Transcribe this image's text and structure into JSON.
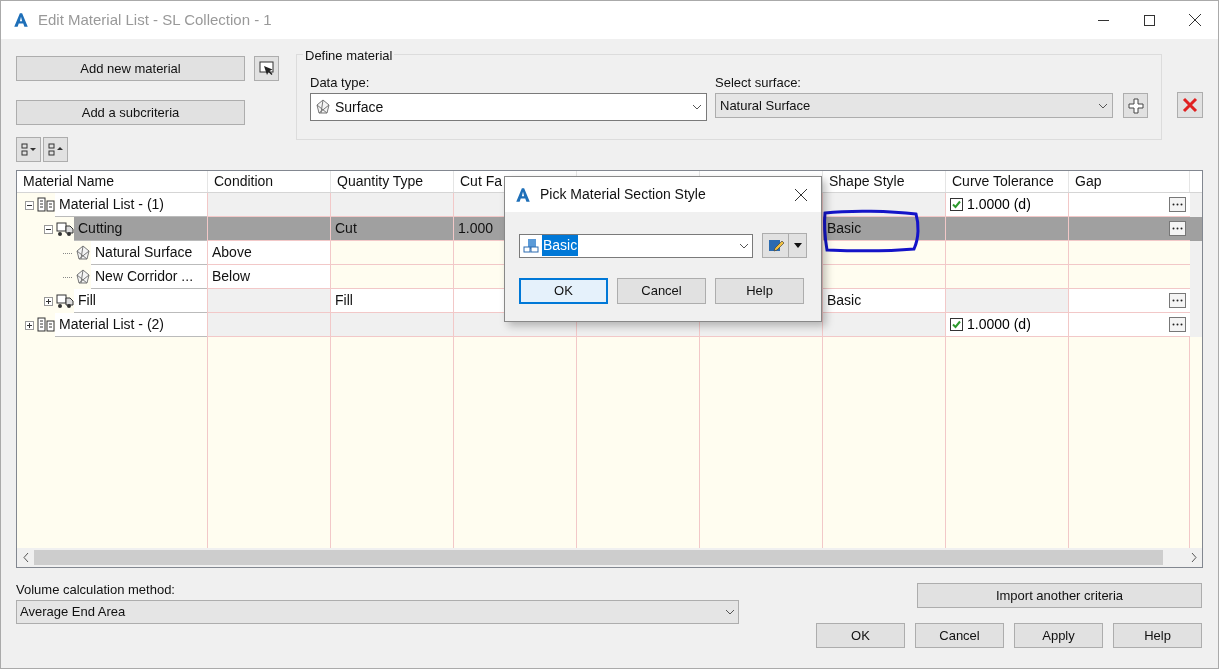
{
  "window": {
    "title": "Edit Material List - SL Collection - 1"
  },
  "actions": [
    {
      "label": "Add new material"
    },
    {
      "label": "Add a subcriteria"
    }
  ],
  "define_material": {
    "title": "Define material",
    "data_type": {
      "label": "Data type:",
      "value": "Surface"
    },
    "select_surface": {
      "label": "Select surface:",
      "value": "Natural Surface"
    }
  },
  "table": {
    "columns": [
      {
        "label": "Material Name"
      },
      {
        "label": "Condition"
      },
      {
        "label": "Quantity Type"
      },
      {
        "label": "Cut Fa"
      },
      {},
      {},
      {
        "label": "Shape Style"
      },
      {
        "label": "Curve Tolerance"
      },
      {
        "label": "Gap"
      }
    ],
    "rows": [
      {
        "kind": "list",
        "name": "Material List - (1)",
        "expanded": true,
        "selected": false,
        "curve_tolerance": {
          "checked": true,
          "value": "1.0000 (d)"
        },
        "children": [
          {
            "kind": "criteria",
            "name": "Cutting",
            "expanded": true,
            "selected": true,
            "quantity_type": "Cut",
            "cut_factor": "1.000",
            "shape_style": "Basic",
            "children": [
              {
                "kind": "subcriteria",
                "name": "Natural Surface",
                "condition": "Above",
                "selected": false
              },
              {
                "kind": "subcriteria",
                "name": "New Corridor ...",
                "condition": "Below",
                "selected": false
              }
            ]
          },
          {
            "kind": "criteria",
            "name": "Fill",
            "expanded": false,
            "selected": false,
            "quantity_type": "Fill",
            "shape_style": "Basic"
          }
        ]
      },
      {
        "kind": "list",
        "name": "Material List - (2)",
        "expanded": false,
        "selected": false,
        "curve_tolerance": {
          "checked": true,
          "value": "1.0000 (d)"
        }
      }
    ]
  },
  "volume": {
    "label": "Volume calculation method:",
    "value": "Average End Area"
  },
  "import_button": "Import another criteria",
  "buttons": [
    {
      "label": "OK"
    },
    {
      "label": "Cancel"
    },
    {
      "label": "Apply"
    },
    {
      "label": "Help"
    }
  ],
  "dialog": {
    "title": "Pick Material Section Style",
    "style": "Basic",
    "buttons": [
      {
        "label": "OK",
        "default": true
      },
      {
        "label": "Cancel",
        "default": false
      },
      {
        "label": "Help",
        "default": false
      }
    ]
  }
}
